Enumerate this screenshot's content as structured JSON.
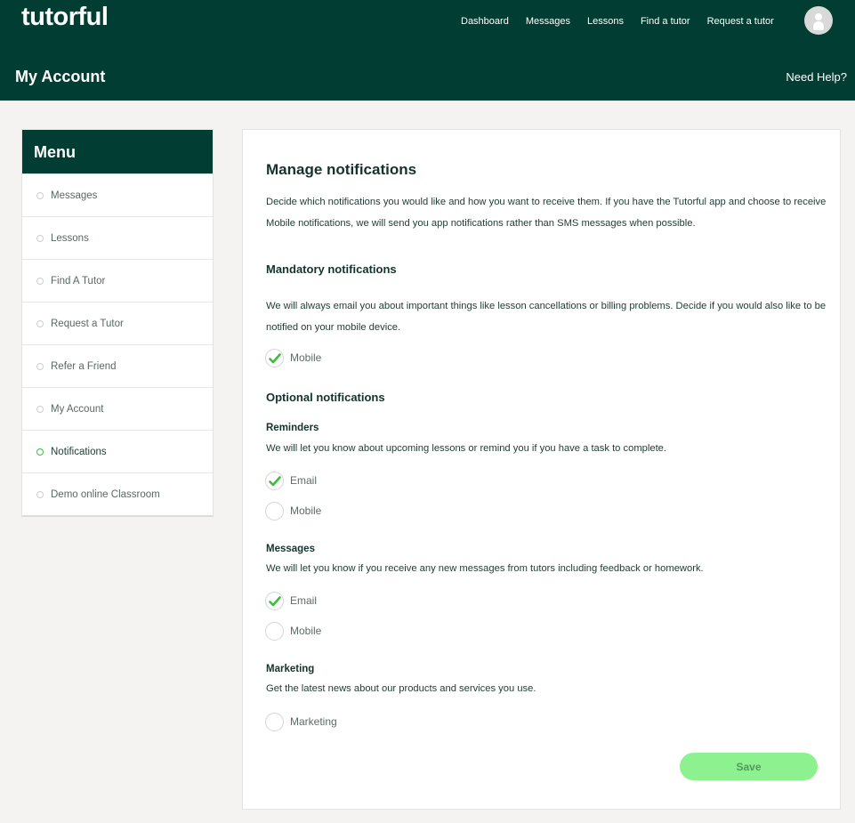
{
  "brand": {
    "logo_text": "tutorful"
  },
  "topnav": {
    "items": [
      {
        "label": "Dashboard"
      },
      {
        "label": "Messages"
      },
      {
        "label": "Lessons"
      },
      {
        "label": "Find a tutor"
      },
      {
        "label": "Request a tutor"
      }
    ]
  },
  "header": {
    "title": "My Account",
    "help": "Need Help?"
  },
  "menu": {
    "title": "Menu",
    "items": [
      {
        "label": "Messages",
        "active": false
      },
      {
        "label": "Lessons",
        "active": false
      },
      {
        "label": "Find A Tutor",
        "active": false
      },
      {
        "label": "Request a Tutor",
        "active": false
      },
      {
        "label": "Refer a Friend",
        "active": false
      },
      {
        "label": "My Account",
        "active": false
      },
      {
        "label": "Notifications",
        "active": true
      },
      {
        "label": "Demo online Classroom",
        "active": false
      }
    ]
  },
  "panel": {
    "title": "Manage notifications",
    "intro": "Decide which notifications you would like and how you want to receive them. If you have the Tutorful app and choose to receive Mobile notifications, we will send you app notifications rather than SMS messages when possible.",
    "mandatory": {
      "title": "Mandatory notifications",
      "desc": "We will always email you about important things like lesson cancellations or billing problems. Decide if you would also like to be notified on your mobile device.",
      "mobile": {
        "label": "Mobile",
        "checked": true
      }
    },
    "optional": {
      "title": "Optional notifications",
      "reminders": {
        "title": "Reminders",
        "desc": "We will let you know about upcoming lessons or remind you if you have a task to complete.",
        "email": {
          "label": "Email",
          "checked": true
        },
        "mobile": {
          "label": "Mobile",
          "checked": false
        }
      },
      "messages": {
        "title": "Messages",
        "desc": "We will let you know if you receive any new messages from tutors including feedback or homework.",
        "email": {
          "label": "Email",
          "checked": true
        },
        "mobile": {
          "label": "Mobile",
          "checked": false
        }
      },
      "marketing": {
        "title": "Marketing",
        "desc": "Get the latest news about our products and services you use.",
        "marketing": {
          "label": "Marketing",
          "checked": false
        }
      }
    },
    "save_label": "Save"
  },
  "colors": {
    "brand_dark_green": "#023d33",
    "check_green": "#3bbf3b",
    "save_button": "#8ef18f",
    "page_background": "#f4f3f1"
  }
}
